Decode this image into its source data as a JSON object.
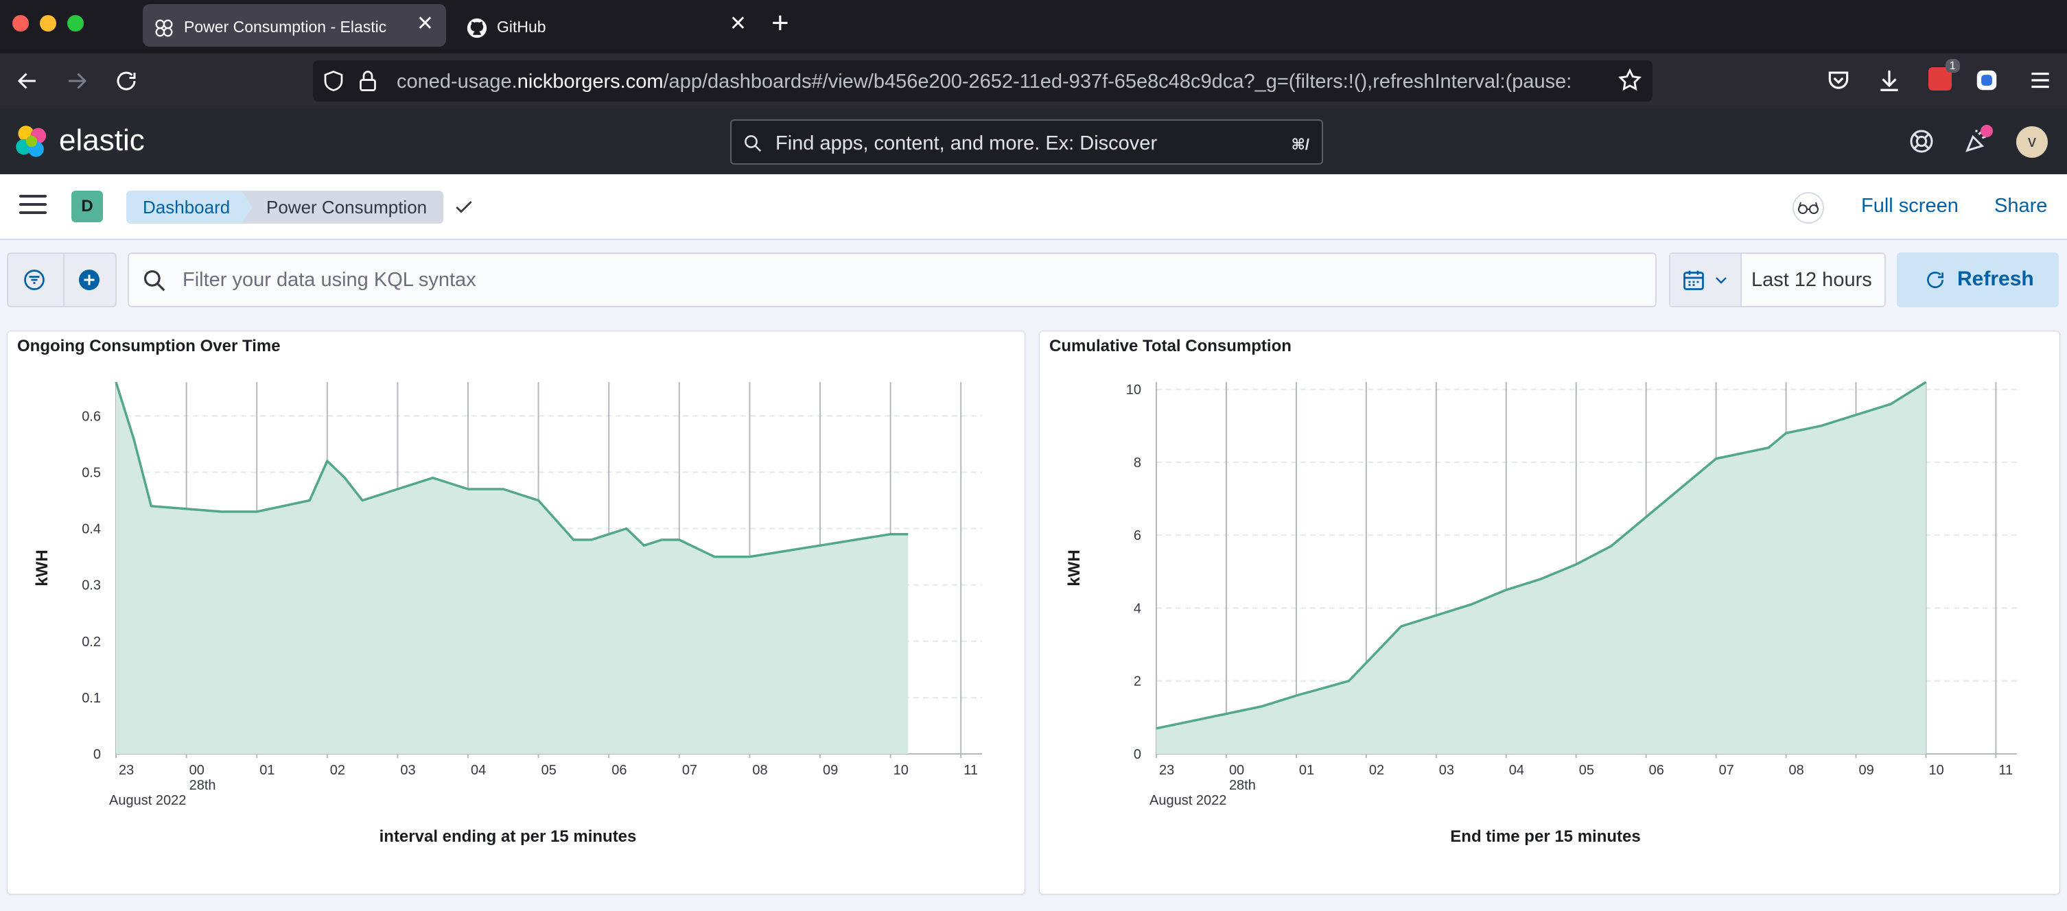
{
  "browser": {
    "tabs": [
      {
        "title": "Power Consumption - Elastic",
        "icon": "elastic-icon",
        "active": true
      },
      {
        "title": "GitHub",
        "icon": "github-icon",
        "active": false
      }
    ],
    "url": {
      "prefix": "coned-usage.",
      "domain": "nickborgers.com",
      "path": "/app/dashboards#/view/b456e200-2652-11ed-937f-65e8c48c9dca?_g=(filters:!(),refreshInterval:(pause:"
    },
    "extension_badge": "1"
  },
  "kibana": {
    "logo_text": "elastic",
    "search_placeholder": "Find apps, content, and more. Ex: Discover",
    "search_shortcut": "⌘/",
    "avatar_initial": "v",
    "space_initial": "D",
    "breadcrumbs": [
      "Dashboard",
      "Power Consumption"
    ],
    "full_screen_label": "Full screen",
    "share_label": "Share"
  },
  "query": {
    "kql_placeholder": "Filter your data using KQL syntax",
    "time_range": "Last 12 hours",
    "refresh_label": "Refresh"
  },
  "colors": {
    "series_line": "#54a88a",
    "series_fill": "#d4e9e1",
    "accent": "#0061a6"
  },
  "chart_data": [
    {
      "type": "area",
      "title": "Ongoing Consumption Over Time",
      "xlabel": "interval ending at per 15 minutes",
      "ylabel": "kWH",
      "ylim": [
        0,
        0.66
      ],
      "yticks": [
        0,
        0.1,
        0.2,
        0.3,
        0.4,
        0.5,
        0.6
      ],
      "x_start": 23.0,
      "x_end": 35.3,
      "xtick_labels": [
        "23",
        "00",
        "01",
        "02",
        "03",
        "04",
        "05",
        "06",
        "07",
        "08",
        "09",
        "10",
        "11"
      ],
      "xtick_hours": [
        23,
        24,
        25,
        26,
        27,
        28,
        29,
        30,
        31,
        32,
        33,
        34,
        35
      ],
      "date_sublabel": "28th",
      "date_label": "August 2022",
      "grid": true,
      "series": [
        {
          "x": [
            23.0,
            23.25,
            23.5,
            24.5,
            25.0,
            25.75,
            26.0,
            26.25,
            26.5,
            27.0,
            27.5,
            28.0,
            28.5,
            29.0,
            29.5,
            29.75,
            30.0,
            30.25,
            30.5,
            30.75,
            31.0,
            31.5,
            32.0,
            32.5,
            33.0,
            33.5,
            34.0,
            34.25
          ],
          "values": [
            0.66,
            0.56,
            0.44,
            0.43,
            0.43,
            0.45,
            0.52,
            0.49,
            0.45,
            0.47,
            0.49,
            0.47,
            0.47,
            0.45,
            0.38,
            0.38,
            0.39,
            0.4,
            0.37,
            0.38,
            0.38,
            0.35,
            0.35,
            0.36,
            0.37,
            0.38,
            0.39,
            0.39
          ]
        }
      ]
    },
    {
      "type": "area",
      "title": "Cumulative Total Consumption",
      "xlabel": "End time per 15 minutes",
      "ylabel": "kWH",
      "ylim": [
        0,
        10.2
      ],
      "yticks": [
        0,
        2,
        4,
        6,
        8,
        10
      ],
      "x_start": 23.0,
      "x_end": 35.3,
      "xtick_labels": [
        "23",
        "00",
        "01",
        "02",
        "03",
        "04",
        "05",
        "06",
        "07",
        "08",
        "09",
        "10",
        "11"
      ],
      "xtick_hours": [
        23,
        24,
        25,
        26,
        27,
        28,
        29,
        30,
        31,
        32,
        33,
        34,
        35
      ],
      "date_sublabel": "28th",
      "date_label": "August 2022",
      "grid": true,
      "series": [
        {
          "x": [
            23.0,
            23.5,
            24.5,
            25.0,
            25.75,
            26.0,
            26.5,
            27.0,
            27.5,
            28.0,
            28.5,
            29.0,
            29.5,
            30.0,
            31.0,
            31.75,
            32.0,
            32.5,
            33.0,
            33.5,
            34.0
          ],
          "values": [
            0.7,
            0.9,
            1.3,
            1.6,
            2.0,
            2.5,
            3.5,
            3.8,
            4.1,
            4.5,
            4.8,
            5.2,
            5.7,
            6.5,
            8.1,
            8.4,
            8.8,
            9.0,
            9.3,
            9.6,
            10.2
          ]
        }
      ]
    }
  ]
}
